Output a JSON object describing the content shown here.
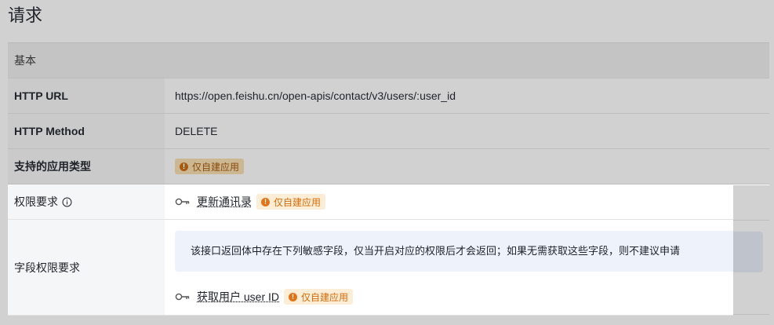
{
  "page": {
    "title": "请求"
  },
  "table": {
    "header": "基本",
    "rows": [
      {
        "label": "HTTP URL",
        "value": "https://open.feishu.cn/open-apis/contact/v3/users/:user_id"
      },
      {
        "label": "HTTP Method",
        "value": "DELETE"
      },
      {
        "label": "支持的应用类型",
        "badge": "仅自建应用"
      }
    ],
    "permission": {
      "label": "权限要求",
      "info_icon": "info-circle-icon",
      "key_icon": "key-icon",
      "name": "更新通讯录",
      "badge": "仅自建应用"
    },
    "field_permission": {
      "label": "字段权限要求",
      "notice": "该接口返回体中存在下列敏感字段，仅当开启对应的权限后才会返回；如果无需获取这些字段，则不建议申请",
      "name": "获取用户 user ID",
      "badge": "仅自建应用"
    }
  },
  "colors": {
    "badge_bg": "#fceed6",
    "badge_text": "#d46b08",
    "notice_bg": "#eef2fb",
    "overlay": "#d1d1d1"
  }
}
